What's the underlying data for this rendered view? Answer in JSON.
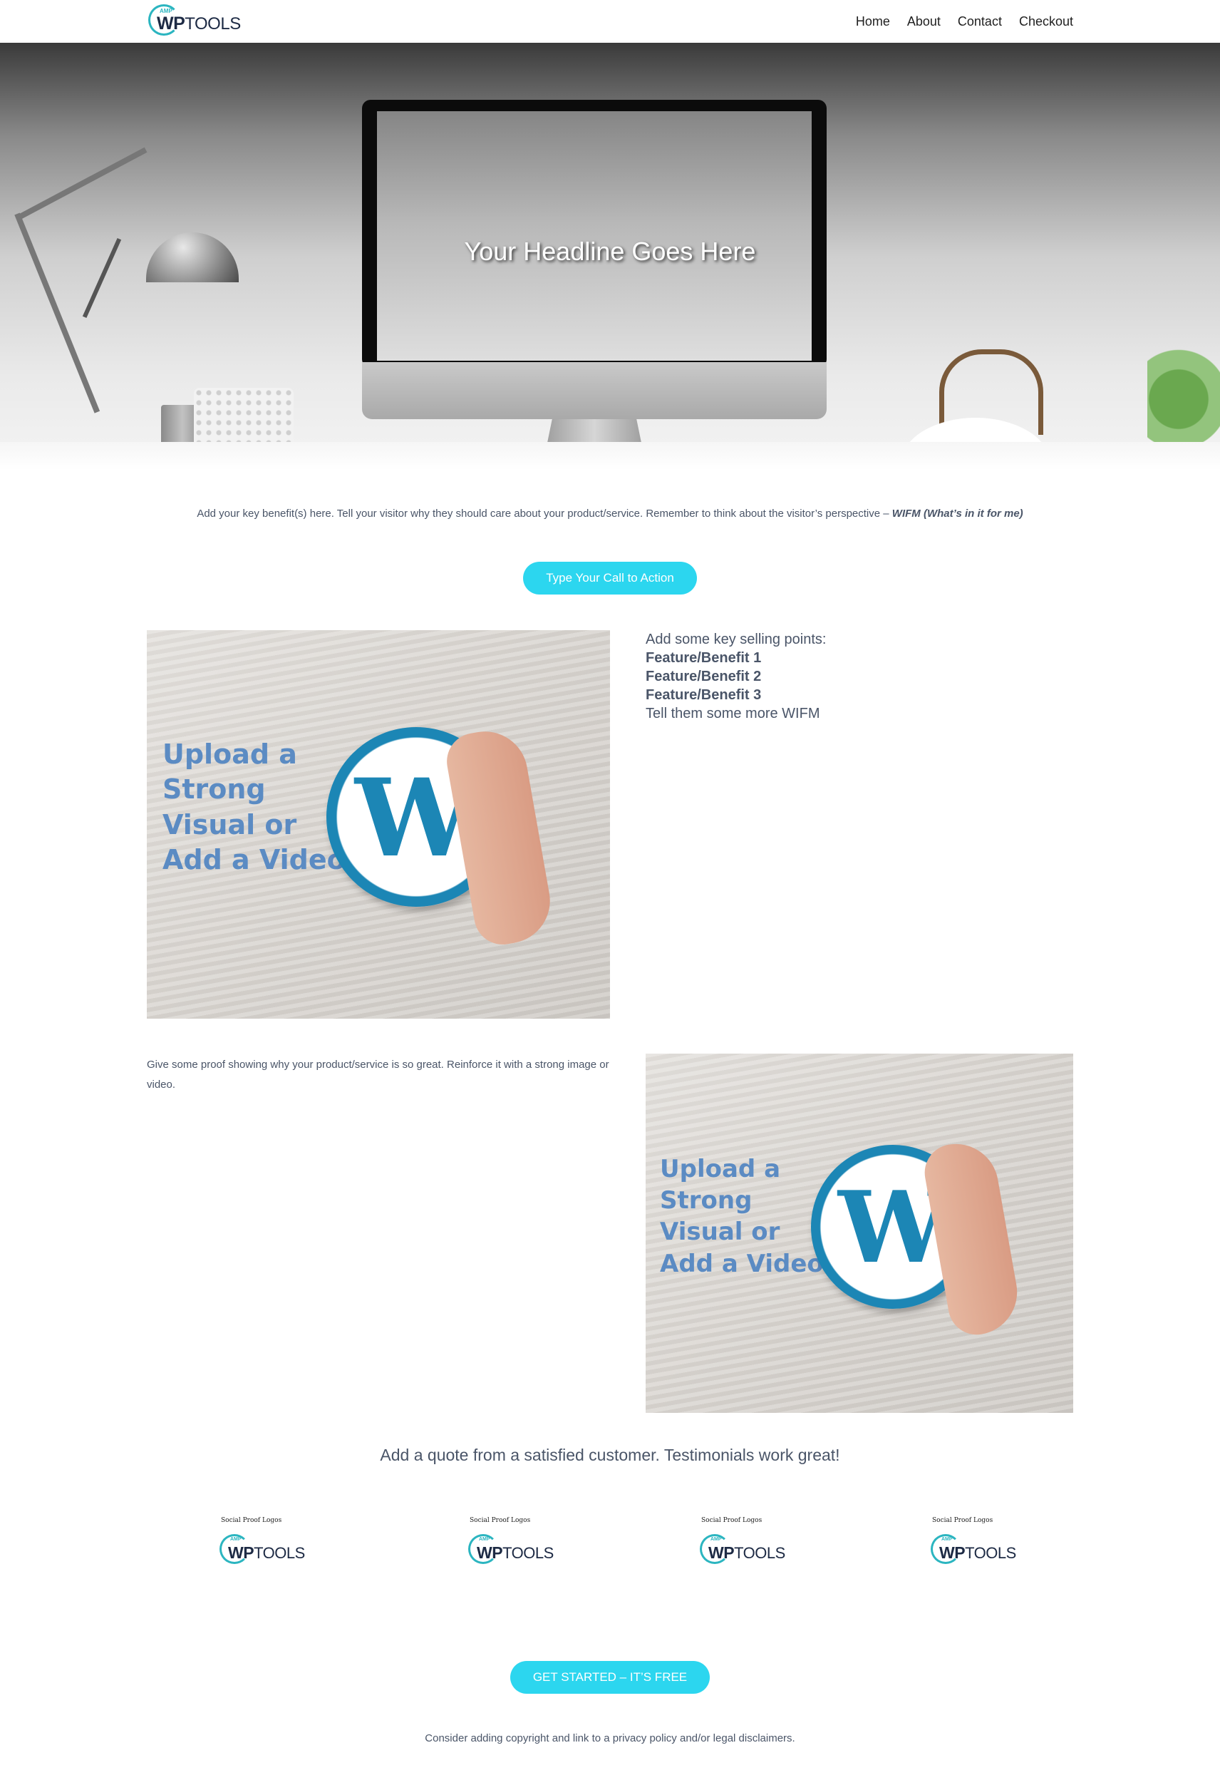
{
  "header": {
    "logo": {
      "amp": "AMP",
      "wp": "WP",
      "tools": "TOOLS"
    },
    "nav": [
      "Home",
      "About",
      "Contact",
      "Checkout"
    ]
  },
  "hero": {
    "headline": "Your Headline Goes Here",
    "apple_glyph": ""
  },
  "benefit": {
    "text": "Add your key benefit(s) here. Tell your visitor why they should care about your product/service. Remember to think about the visitor’s perspective – ",
    "emphasis": "WIFM (What’s in it for me)"
  },
  "cta_primary": "Type Your Call to Action",
  "feature_image": {
    "overlay_lines": [
      "Upload a",
      "Strong",
      "Visual or",
      "Add a Video"
    ],
    "logo_letter": "W"
  },
  "selling_points": {
    "intro": "Add some key selling points:",
    "features": [
      "Feature/Benefit 1",
      "Feature/Benefit 2",
      "Feature/Benefit 3"
    ],
    "outro": "Tell them some more WIFM"
  },
  "proof_text": "Give some proof showing why your product/service is so great. Reinforce it with a strong image or video.",
  "proof_image": {
    "overlay_lines": [
      "Upload a",
      "Strong",
      "Visual or",
      "Add a Video"
    ],
    "logo_letter": "W"
  },
  "testimonial": "Add a quote from a satisfied customer. Testimonials work great!",
  "social_proof": [
    {
      "caption": "Social Proof Logos",
      "amp": "AMP",
      "wp": "WP",
      "tools": "TOOLS"
    },
    {
      "caption": "Social Proof Logos",
      "amp": "AMP",
      "wp": "WP",
      "tools": "TOOLS"
    },
    {
      "caption": "Social Proof Logos",
      "amp": "AMP",
      "wp": "WP",
      "tools": "TOOLS"
    },
    {
      "caption": "Social Proof Logos",
      "amp": "AMP",
      "wp": "WP",
      "tools": "TOOLS"
    }
  ],
  "cta_secondary": "GET STARTED – IT’S FREE",
  "footer": "Consider adding copyright and link to a privacy policy and/or legal disclaimers.",
  "colors": {
    "accent": "#2cd6ef",
    "logo_teal": "#2bb5c0",
    "logo_navy": "#1d2a44",
    "text": "#4a5568",
    "wordpress_blue": "#1c86b5",
    "overlay_text": "#5b8bc3"
  }
}
